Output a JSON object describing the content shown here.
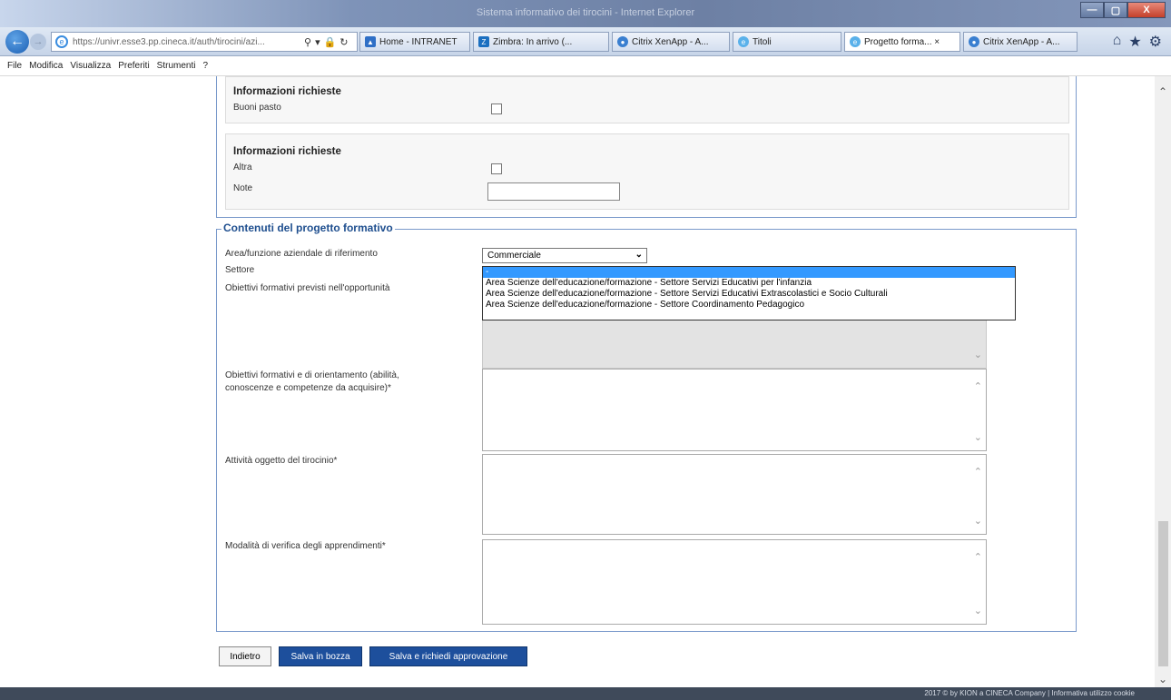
{
  "window": {
    "title": "Sistema informativo dei tirocini - Internet Explorer",
    "controls": [
      "—",
      "▢",
      "X"
    ]
  },
  "nav": {
    "url": "https://univr.esse3.pp.cineca.it/auth/tirocini/azi...",
    "tabs": [
      {
        "label": "Home - INTRANET",
        "active": false
      },
      {
        "label": "Zimbra: In arrivo (...",
        "active": false
      },
      {
        "label": "Citrix XenApp - A...",
        "active": false
      },
      {
        "label": "Titoli",
        "active": false
      },
      {
        "label": "Progetto forma... ×",
        "active": true
      },
      {
        "label": "Citrix XenApp - A...",
        "active": false
      }
    ]
  },
  "menu": [
    "File",
    "Modifica",
    "Visualizza",
    "Preferiti",
    "Strumenti",
    "?"
  ],
  "info1": {
    "title": "Informazioni richieste",
    "field_label": "Buoni pasto"
  },
  "info2": {
    "title": "Informazioni richieste",
    "altra_label": "Altra",
    "note_label": "Note",
    "note_value": ""
  },
  "contenuti": {
    "legend": "Contenuti del progetto formativo",
    "area_label": "Area/funzione aziendale di riferimento",
    "area_value": "Commerciale",
    "settore_label": "Settore",
    "obiettivi_label": "Obiettivi formativi previsti nell'opportunità",
    "settore_options": [
      "-",
      "Area Scienze dell'educazione/formazione - Settore Servizi Educativi per l'infanzia",
      "Area Scienze dell'educazione/formazione - Settore Servizi Educativi Extrascolastici e Socio Culturali",
      "Area Scienze dell'educazione/formazione - Settore Coordinamento Pedagogico"
    ],
    "obiettivi_orient_label_1": "Obiettivi formativi e di orientamento (abilità,",
    "obiettivi_orient_label_2": "conoscenze e competenze da acquisire)*",
    "attivita_label": "Attività oggetto del tirocinio*",
    "verifica_label": "Modalità di verifica degli apprendimenti*"
  },
  "buttons": {
    "back": "Indietro",
    "save_draft": "Salva in bozza",
    "save_request": "Salva e richiedi approvazione"
  },
  "footer": {
    "text": "2017 © by KION a CINECA Company | Informativa utilizzo cookie"
  }
}
